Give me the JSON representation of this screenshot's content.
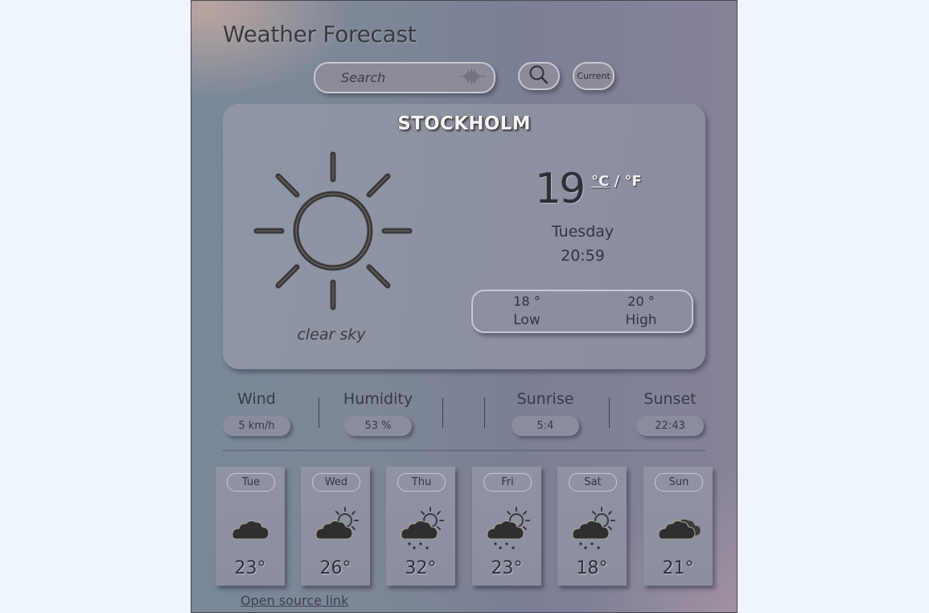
{
  "header": {
    "title": "Weather Forecast"
  },
  "search": {
    "placeholder": "Search",
    "value": "",
    "search_button_icon": "search-icon",
    "voice_icon": "voice-waveform-icon",
    "current_label": "Current"
  },
  "current": {
    "city": "STOCKHOLM",
    "icon": "sun-icon",
    "description": "clear sky",
    "temperature": "19",
    "unit_celsius": "°C",
    "unit_separator": " / ",
    "unit_fahrenheit": "°F",
    "day": "Tuesday",
    "time": "20:59",
    "low_value": "18 °",
    "low_label": "Low",
    "high_value": "20 °",
    "high_label": "High"
  },
  "stats": [
    {
      "label": "Wind",
      "value": "5 km/h"
    },
    {
      "label": "Humidity",
      "value": "53 %"
    },
    {
      "label": "Sunrise",
      "value": "5:4"
    },
    {
      "label": "Sunset",
      "value": "22:43"
    }
  ],
  "forecast": [
    {
      "day": "Tue",
      "temp": "23°",
      "icon": "cloud-icon"
    },
    {
      "day": "Wed",
      "temp": "26°",
      "icon": "partly-cloudy-icon"
    },
    {
      "day": "Thu",
      "temp": "32°",
      "icon": "sun-cloud-snow-icon"
    },
    {
      "day": "Fri",
      "temp": "23°",
      "icon": "sun-cloud-snow-icon"
    },
    {
      "day": "Sat",
      "temp": "18°",
      "icon": "sun-cloud-snow-icon"
    },
    {
      "day": "Sun",
      "temp": "21°",
      "icon": "clouds-icon"
    }
  ],
  "footer": {
    "link_label": "Open source link"
  },
  "colors": {
    "page_background": "#eef5fd",
    "text_dark": "#34343c",
    "city_text": "#f3f3f3",
    "icon_stroke": "#3a3a3e"
  }
}
